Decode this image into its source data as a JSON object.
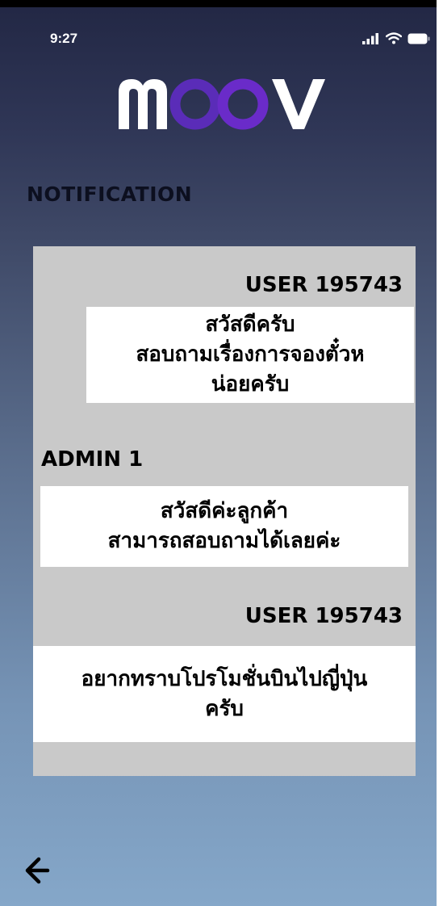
{
  "status_bar": {
    "time": "9:27",
    "icons": [
      "signal-icon",
      "wifi-icon",
      "battery-icon"
    ]
  },
  "app": {
    "logo_text": "MOOV",
    "logo_colors": {
      "white": "#ffffff",
      "purple": "#6a2bc9"
    }
  },
  "page": {
    "title": "NOTIFICATION"
  },
  "messages": [
    {
      "sender": "USER 195743",
      "text": "สวัสดีครับ\nสอบถามเรื่องการจองตั๋วห\nน่อยครับ",
      "align": "right"
    },
    {
      "sender": "ADMIN 1",
      "text": "สวัสดีค่ะลูกค้า\nสามารถสอบถามได้เลยค่ะ",
      "align": "left"
    },
    {
      "sender": "USER 195743",
      "text": "อยากทราบโปรโมชั่นบินไปญี่ปุ่น\nครับ",
      "align": "right"
    }
  ],
  "nav": {
    "back_icon": "back-arrow-icon"
  }
}
